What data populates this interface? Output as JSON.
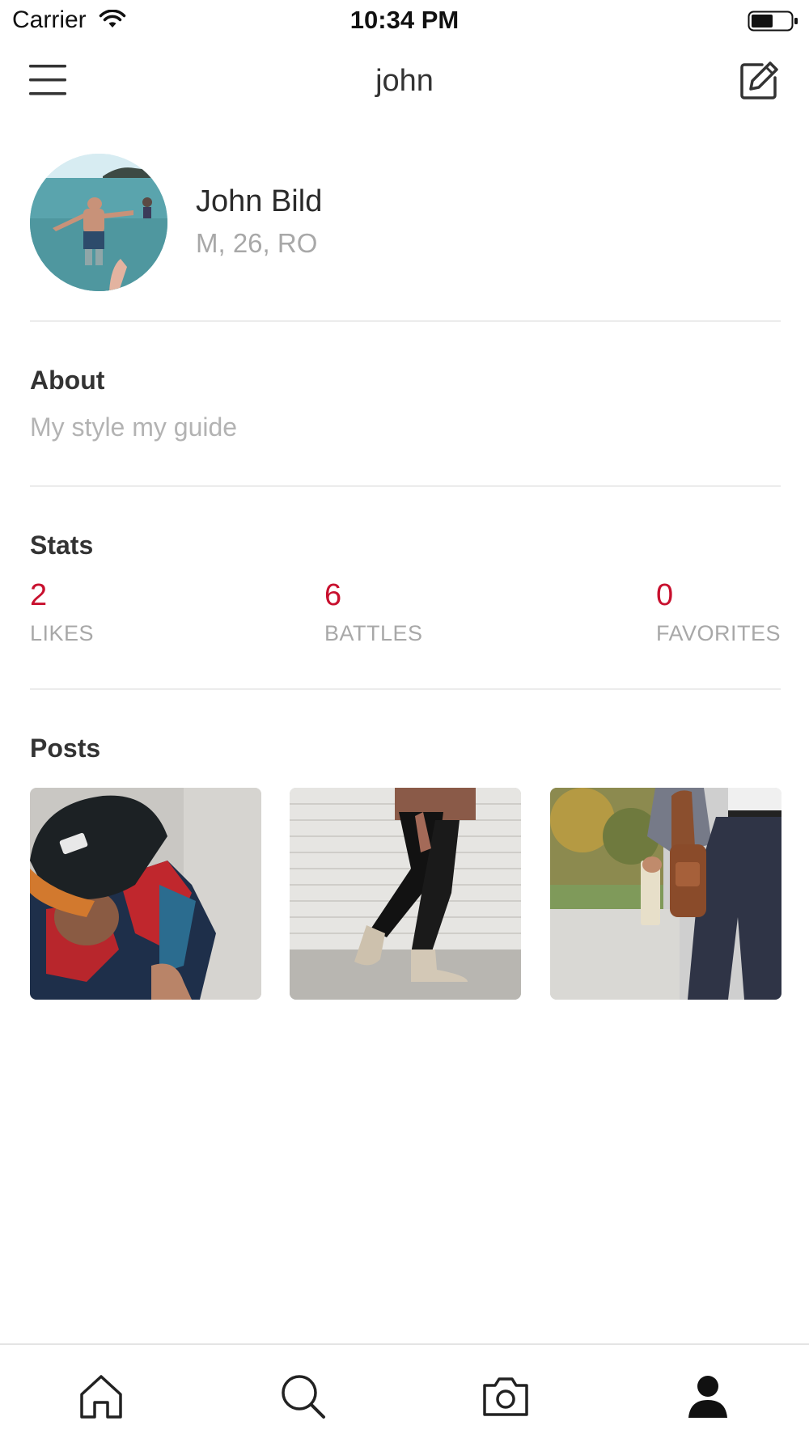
{
  "status_bar": {
    "carrier": "Carrier",
    "time": "10:34 PM"
  },
  "nav": {
    "title": "john"
  },
  "profile": {
    "name": "John Bild",
    "details": "M, 26, RO"
  },
  "about": {
    "title": "About",
    "text": "My style my guide"
  },
  "stats": {
    "title": "Stats",
    "items": [
      {
        "value": "2",
        "label": "LIKES"
      },
      {
        "value": "6",
        "label": "BATTLES"
      },
      {
        "value": "0",
        "label": "FAVORITES"
      }
    ]
  },
  "posts": {
    "title": "Posts"
  },
  "colors": {
    "accent": "#c8102e",
    "muted": "#a8a8a8",
    "divider": "#ececec"
  },
  "icons": {
    "nav_left": "hamburger-menu-icon",
    "nav_right": "edit-icon",
    "tabs": [
      "home-icon",
      "search-icon",
      "camera-icon",
      "profile-icon"
    ]
  },
  "tab_bar": {
    "active_tab": "profile"
  }
}
